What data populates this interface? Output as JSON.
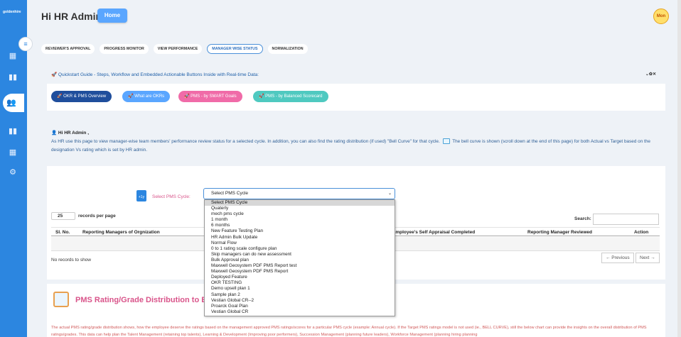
{
  "sidebar": {
    "logo": "goldenhire",
    "icons": [
      "dashboard-icon",
      "book-icon",
      "team-icon",
      "book-icon",
      "report-icon",
      "settings-icon"
    ]
  },
  "header": {
    "title": "Hi HR Admin",
    "home_label": "Home",
    "avatar_text": "Mon"
  },
  "tabs": [
    {
      "label": "REVIEWER'S APPROVAL",
      "active": false
    },
    {
      "label": "PROGRESS MONITOR",
      "active": false
    },
    {
      "label": "VIEW PERFORMANCE",
      "active": false
    },
    {
      "label": "MANAGER WISE STATUS",
      "active": true
    },
    {
      "label": "NORMALIZATION",
      "active": false
    }
  ],
  "quickstart": {
    "text": "Quickstart Guide - Steps, Workflow and Embedded Actionable Buttons Inside with Real-time Data:",
    "controls": "⌄✿✕",
    "pills": [
      {
        "label": "OKR & PMS Overview",
        "color": "#1f4e9c"
      },
      {
        "label": "What are OKRs",
        "color": "#5aa6ff"
      },
      {
        "label": "PMS - by SMART Goals",
        "color": "#f06ba8"
      },
      {
        "label": "PMS - by Balanced Scorecard",
        "color": "#4fc9c0"
      }
    ]
  },
  "info": {
    "greeting": "Hi HR Admin ,",
    "desc_part1": "As HR use this page to view manager-wise team members' performance review status for a selected cycle. In addition, you can also find the rating distribution (if used) \"Bell Curve\" for that cycle.",
    "desc_part2": "The bell curve is shown (scroll down at the end of this page) for both Actual vs Target based on the designation Vs rating which is set by HR admin."
  },
  "cycle": {
    "label": "Select PMS Cycle:",
    "selected": "Select PMS Cycle",
    "options": [
      "Select PMS Cycle",
      "Quaterly",
      "mech pms cycle",
      "1 month",
      "6 months",
      "New Feature Testing Plan",
      "HR Admin Bulk Update",
      "Normal Flow",
      "0 to 1 rating scale configure plan",
      "Skip managers can do new assessment",
      "Bulk Approval plan",
      "Maxwell Geosystem PDF PMS Report test",
      "Maxwell Geosystem PDF PMS Report",
      "Deployed Feature",
      "OKR TESTING",
      "Demo upsell plan 1",
      "Sample plan 2",
      "Vestian Global CR--2",
      "Proarck Goal Plan",
      "Vestian Global CR"
    ]
  },
  "table": {
    "page_size": "25",
    "records_label": "records per page",
    "search_label": "Search:",
    "headers": {
      "sl_no": "Sl. No.",
      "managers": "Reporting Managers of Orgnization",
      "self_appraisal": "Employee's Self Appraisal Completed",
      "reviewed": "Reporting Manager Reviewed",
      "action": "Action"
    },
    "empty_text": "No records to show",
    "prev_label": "← Previous",
    "next_label": "Next →"
  },
  "distribution": {
    "title": "PMS Rating/Grade Distribution to Emplo",
    "desc_part1": "The actual PMS rating/grade distribution shows, how the employee deserve the ratings based on the management approved PMS ratings/scores for a particular PMS cycle (example: Annual cycle). If the Target PMS ratings model is not used",
    "desc_part2": "(ie., BELL CURVE), still the below chart can provide the insights on the overall distribution of PMS ratings/grades. This data can help plan the Talent Management (retaining top talents), Learning & Development (Improving poor performers), Succession Management (planning future leaders), Workforce Management (planning hiring planning"
  }
}
